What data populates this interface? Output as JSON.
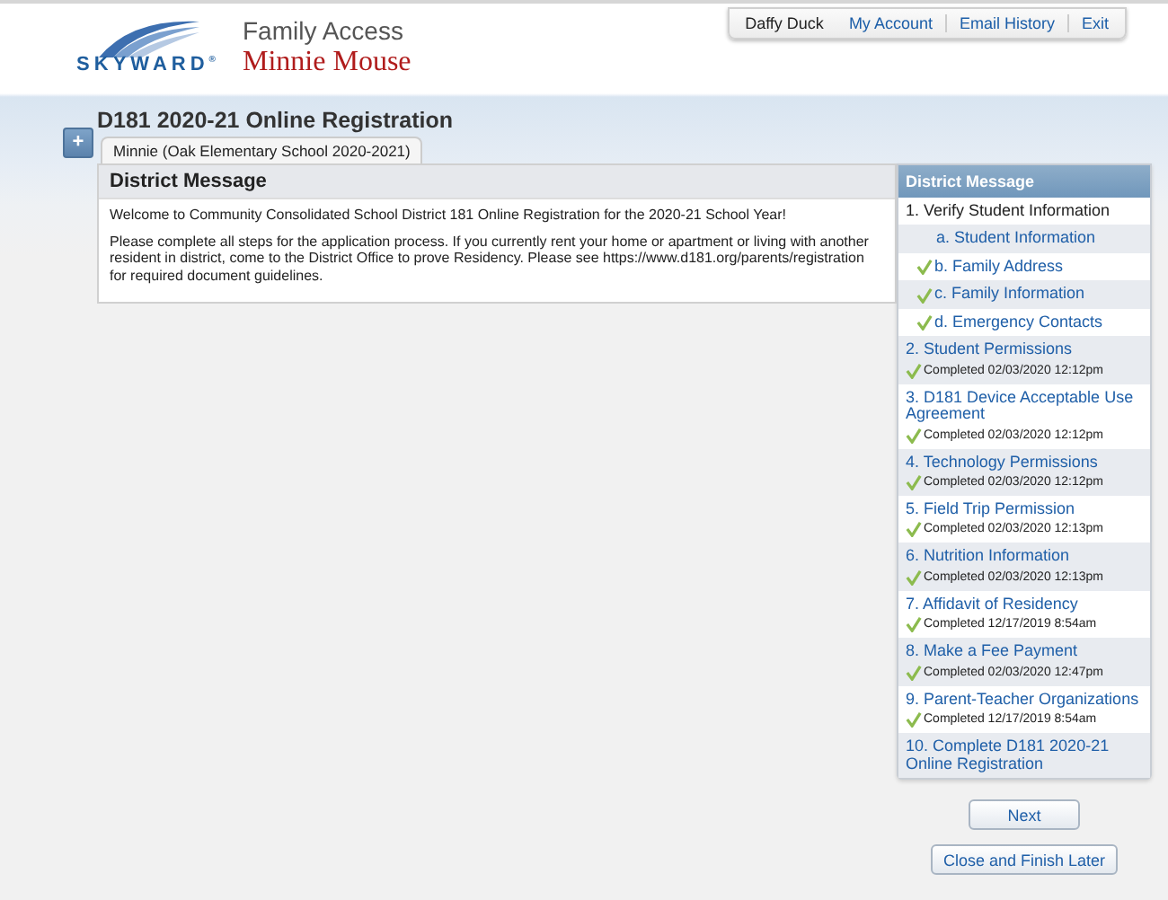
{
  "header": {
    "logo_text": "SKYWARD$^{®}$",
    "product": "Family Access",
    "student_name": "Minnie Mouse"
  },
  "account_nav": [
    {
      "label": "Daffy Duck",
      "kind": "user"
    },
    {
      "label": "My Account",
      "kind": "link"
    },
    {
      "label": "Email History",
      "kind": "link"
    },
    {
      "label": "Exit",
      "kind": "link"
    }
  ],
  "page_title": "D181 2020-21 Online Registration",
  "expand_button": "+",
  "tabs": [
    {
      "label": "Minnie (Oak Elementary School 2020-2021)",
      "selected": true
    }
  ],
  "message": {
    "title": "District Message",
    "paragraphs": [
      "Welcome to Community Consolidated School District 181 Online Registration for the 2020-21 School Year!",
      "Please complete all steps for the application process. If you currently rent your home or apartment or living with another resident in district, come to the District Office to prove Residency. Please see https://www.d181.org/parents/registration for required document guidelines."
    ]
  },
  "steps_panel": {
    "title": "District Message",
    "items": [
      {
        "kind": "header",
        "label": "1. Verify Student Information",
        "checked": false
      },
      {
        "kind": "sub",
        "label": "a. Student Information",
        "checked": false
      },
      {
        "kind": "sub",
        "label": "b. Family Address",
        "checked": true
      },
      {
        "kind": "sub",
        "label": "c. Family Information",
        "checked": true
      },
      {
        "kind": "sub",
        "label": "d. Emergency Contacts",
        "checked": true
      },
      {
        "kind": "step",
        "label": "2. Student Permissions",
        "checked": true,
        "status": "Completed 02/03/2020 12:12pm"
      },
      {
        "kind": "step",
        "label": "3. D181 Device Acceptable Use Agreement",
        "checked": true,
        "status": "Completed 02/03/2020 12:12pm"
      },
      {
        "kind": "step",
        "label": "4. Technology Permissions",
        "checked": true,
        "status": "Completed 02/03/2020 12:12pm"
      },
      {
        "kind": "step",
        "label": "5. Field Trip Permission",
        "checked": true,
        "status": "Completed 02/03/2020 12:13pm"
      },
      {
        "kind": "step",
        "label": "6. Nutrition Information",
        "checked": true,
        "status": "Completed 02/03/2020 12:13pm"
      },
      {
        "kind": "step",
        "label": "7. Affidavit of Residency",
        "checked": true,
        "status": "Completed 12/17/2019 8:54am"
      },
      {
        "kind": "step",
        "label": "8. Make a Fee Payment",
        "checked": true,
        "status": "Completed 02/03/2020 12:47pm"
      },
      {
        "kind": "step",
        "label": "9. Parent-Teacher Organizations",
        "checked": true,
        "status": "Completed 12/17/2019 8:54am"
      },
      {
        "kind": "step",
        "label": "10. Complete D181 2020-21 Online Registration",
        "checked": false
      }
    ]
  },
  "buttons": [
    "Next",
    "Close and Finish Later"
  ]
}
